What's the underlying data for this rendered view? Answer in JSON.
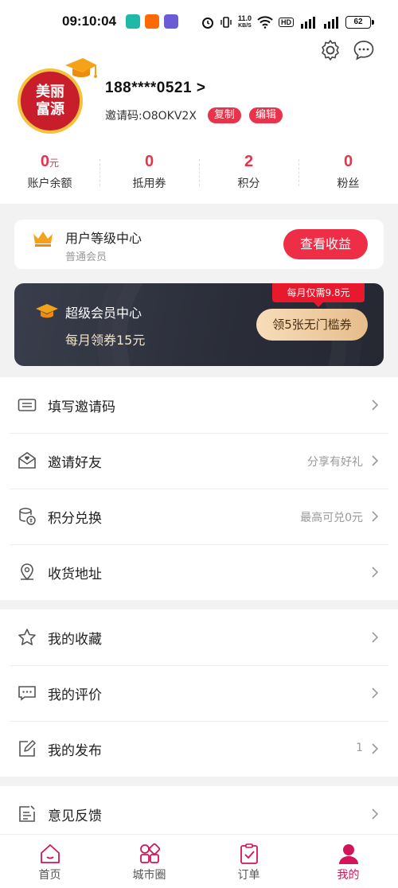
{
  "status_bar": {
    "time": "09:10:04",
    "net_speed_top": "11.0",
    "net_speed_unit": "KB/S",
    "hd": "HD",
    "battery": "62"
  },
  "profile": {
    "avatar_text_line1": "美丽",
    "avatar_text_line2": "富源",
    "phone": "188****0521 >",
    "invite_code": "邀请码:O8OKV2X",
    "copy_label": "复制",
    "edit_label": "编辑"
  },
  "stats": [
    {
      "value": "0",
      "unit": "元",
      "label": "账户余额"
    },
    {
      "value": "0",
      "unit": "",
      "label": "抵用券"
    },
    {
      "value": "2",
      "unit": "",
      "label": "积分"
    },
    {
      "value": "0",
      "unit": "",
      "label": "粉丝"
    }
  ],
  "level_card": {
    "title": "用户等级中心",
    "subtitle": "普通会员",
    "button": "查看收益"
  },
  "vip_card": {
    "title": "超级会员中心",
    "subtitle": "每月领券15元",
    "tag": "每月仅需9.8元",
    "button": "领5张无门槛券"
  },
  "menu_group_1": [
    {
      "label": "填写邀请码",
      "extra": "",
      "icon": "ticket-icon"
    },
    {
      "label": "邀请好友",
      "extra": "分享有好礼",
      "icon": "envelope-heart-icon"
    },
    {
      "label": "积分兑换",
      "extra": "最高可兑0元",
      "icon": "coins-icon"
    },
    {
      "label": "收货地址",
      "extra": "",
      "icon": "location-pin-icon"
    }
  ],
  "menu_group_2": [
    {
      "label": "我的收藏",
      "extra": "",
      "icon": "star-icon"
    },
    {
      "label": "我的评价",
      "extra": "",
      "icon": "comment-icon"
    },
    {
      "label": "我的发布",
      "extra": "1",
      "icon": "edit-icon"
    }
  ],
  "menu_group_3": [
    {
      "label": "意见反馈",
      "extra": "",
      "icon": "feedback-icon"
    }
  ],
  "tabs": [
    {
      "label": "首页",
      "icon": "home-icon",
      "active": false
    },
    {
      "label": "城市圈",
      "icon": "grid-icon",
      "active": false
    },
    {
      "label": "订单",
      "icon": "clipboard-icon",
      "active": false
    },
    {
      "label": "我的",
      "icon": "user-icon",
      "active": true
    }
  ],
  "colors": {
    "accent": "#e8334a",
    "tab_active": "#d4145a",
    "vip_bg": "#2a2d38",
    "vip_gold": "#f0e2c8"
  }
}
